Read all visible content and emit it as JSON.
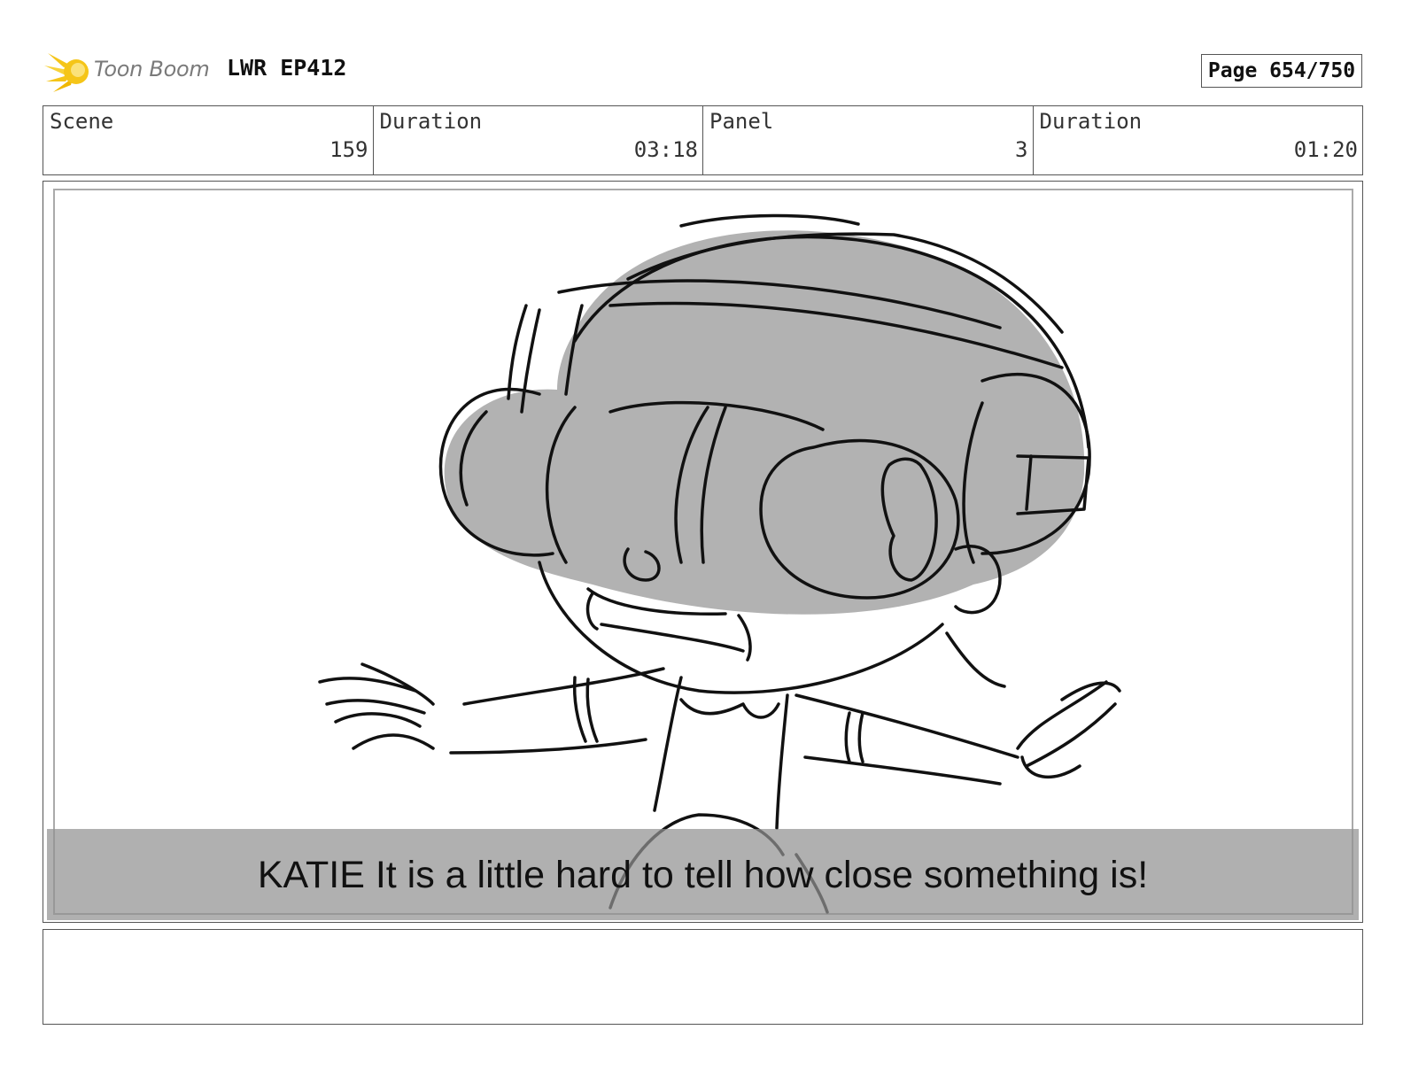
{
  "header": {
    "logo_text": "Toon Boom",
    "project_title": "LWR EP412",
    "page_label": "Page 654/750"
  },
  "info": {
    "scene": {
      "label": "Scene",
      "value": "159"
    },
    "scene_duration": {
      "label": "Duration",
      "value": "03:18"
    },
    "panel": {
      "label": "Panel",
      "value": "3"
    },
    "panel_duration": {
      "label": "Duration",
      "value": "01:20"
    }
  },
  "panel": {
    "image": "storyboard-sketch-katie-with-vr-headset",
    "caption": "KATIE It is a little hard to tell how close something is!"
  },
  "notes": {
    "text": ""
  },
  "colors": {
    "logo_flame": "#f5c518",
    "headset_fill": "#b2b2b2",
    "caption_bar": "#919191"
  }
}
